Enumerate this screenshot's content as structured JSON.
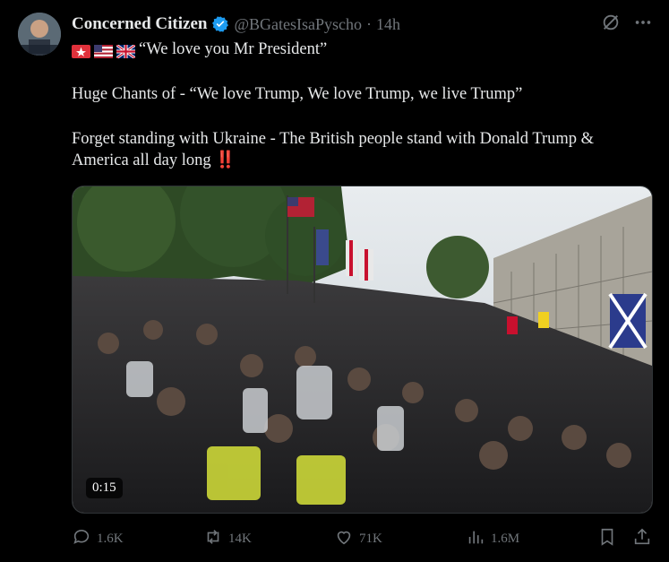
{
  "author": {
    "display_name": "Concerned Citizen",
    "handle": "@BGatesIsaPyscho",
    "separator": "·",
    "time": "14h"
  },
  "tweet": {
    "line1_quote": "“We love you Mr President”",
    "line2": "Huge Chants of - “We love Trump, We love Trump, we live Trump”",
    "line3": "Forget standing with Ukraine - The British people stand with Donald Trump & America all day long",
    "line3_emoji": "‼️"
  },
  "media": {
    "duration": "0:15",
    "type": "video"
  },
  "actions": {
    "replies": "1.6K",
    "reposts": "14K",
    "likes": "71K",
    "views": "1.6M"
  },
  "colors": {
    "background": "#000000",
    "text": "#e7e9ea",
    "muted": "#71767b",
    "verified": "#1d9bf0"
  },
  "icons": [
    "verified-badge-icon",
    "grok-icon",
    "more-icon",
    "siren-icon",
    "us-flag-icon",
    "uk-flag-icon",
    "reply-icon",
    "repost-icon",
    "like-icon",
    "views-icon",
    "bookmark-icon",
    "share-icon"
  ]
}
